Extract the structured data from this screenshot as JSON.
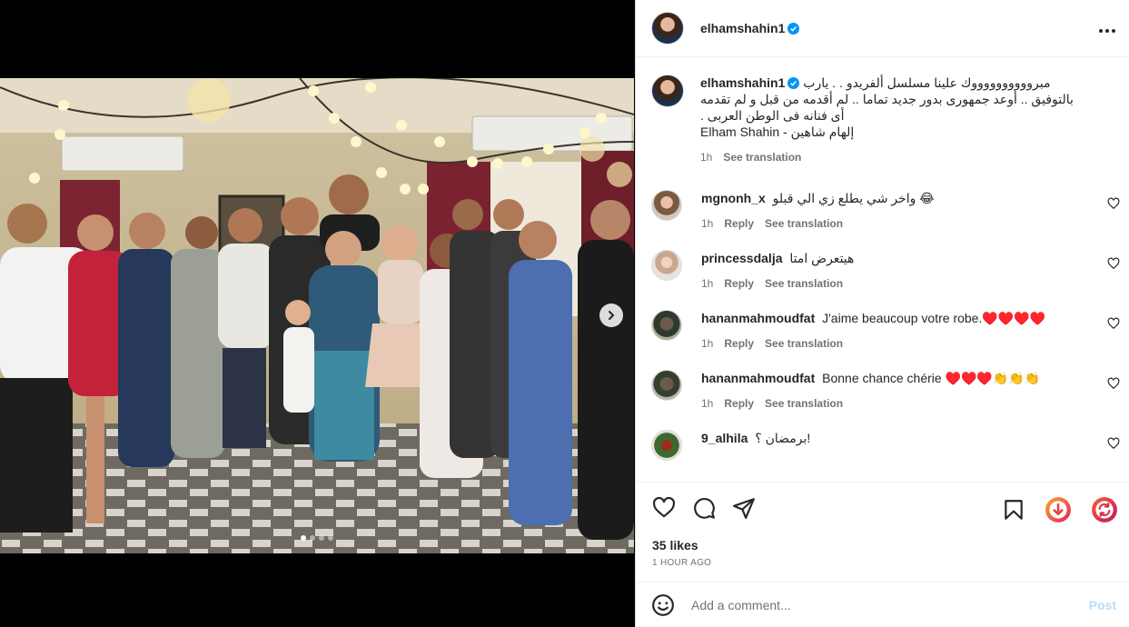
{
  "post": {
    "username": "elhamshahin1",
    "more_icon": "more-horizontal-icon",
    "verified_icon": "verified-badge-icon"
  },
  "caption": {
    "username": "elhamshahin1",
    "lines": [
      "مبرووووووووووك علينا مسلسل ألفريدو . . يارب",
      "بالتوفيق .. أوعد جمهورى بدور جديد تماما .. لم أقدمه من قبل و لم تقدمه",
      "أى فنانه فى الوطن العربى .",
      "Elham Shahin - إلهام شاهين"
    ],
    "time": "1h",
    "see_translation": "See translation"
  },
  "comments": [
    {
      "username": "mgnonh_x",
      "text": "واخر شي يطلع زي الي قبلو 😂",
      "time": "1h",
      "reply": "Reply",
      "see_translation": "See translation"
    },
    {
      "username": "princessdalja",
      "text": "هيتعرض امتا",
      "time": "1h",
      "reply": "Reply",
      "see_translation": "See translation"
    },
    {
      "username": "hananmahmoudfat",
      "text": "J'aime beaucoup votre robe.♥️♥️♥️♥️",
      "time": "1h",
      "reply": "Reply",
      "see_translation": "See translation"
    },
    {
      "username": "hananmahmoudfat",
      "text": "Bonne chance chérie ♥️♥️♥️👏👏👏",
      "time": "1h",
      "reply": "Reply",
      "see_translation": "See translation"
    },
    {
      "username": "9_alhila",
      "text": "برمضان ؟!",
      "time": "",
      "reply": "",
      "see_translation": ""
    }
  ],
  "actions": {
    "like_icon": "heart-icon",
    "comment_icon": "comment-icon",
    "share_icon": "send-icon",
    "save_icon": "bookmark-icon",
    "download_icon": "download-icon",
    "repost_icon": "repost-icon"
  },
  "likes": "35 likes",
  "posted": "1 HOUR AGO",
  "add_comment": {
    "placeholder": "Add a comment...",
    "post_label": "Post",
    "emoji_icon": "emoji-icon"
  },
  "carousel": {
    "total": 4,
    "active_index": 0
  },
  "colors": {
    "link_blue": "#0095f6",
    "post_disabled": "#b2dffc",
    "muted": "#737373",
    "heart_red": "#ed4956"
  }
}
